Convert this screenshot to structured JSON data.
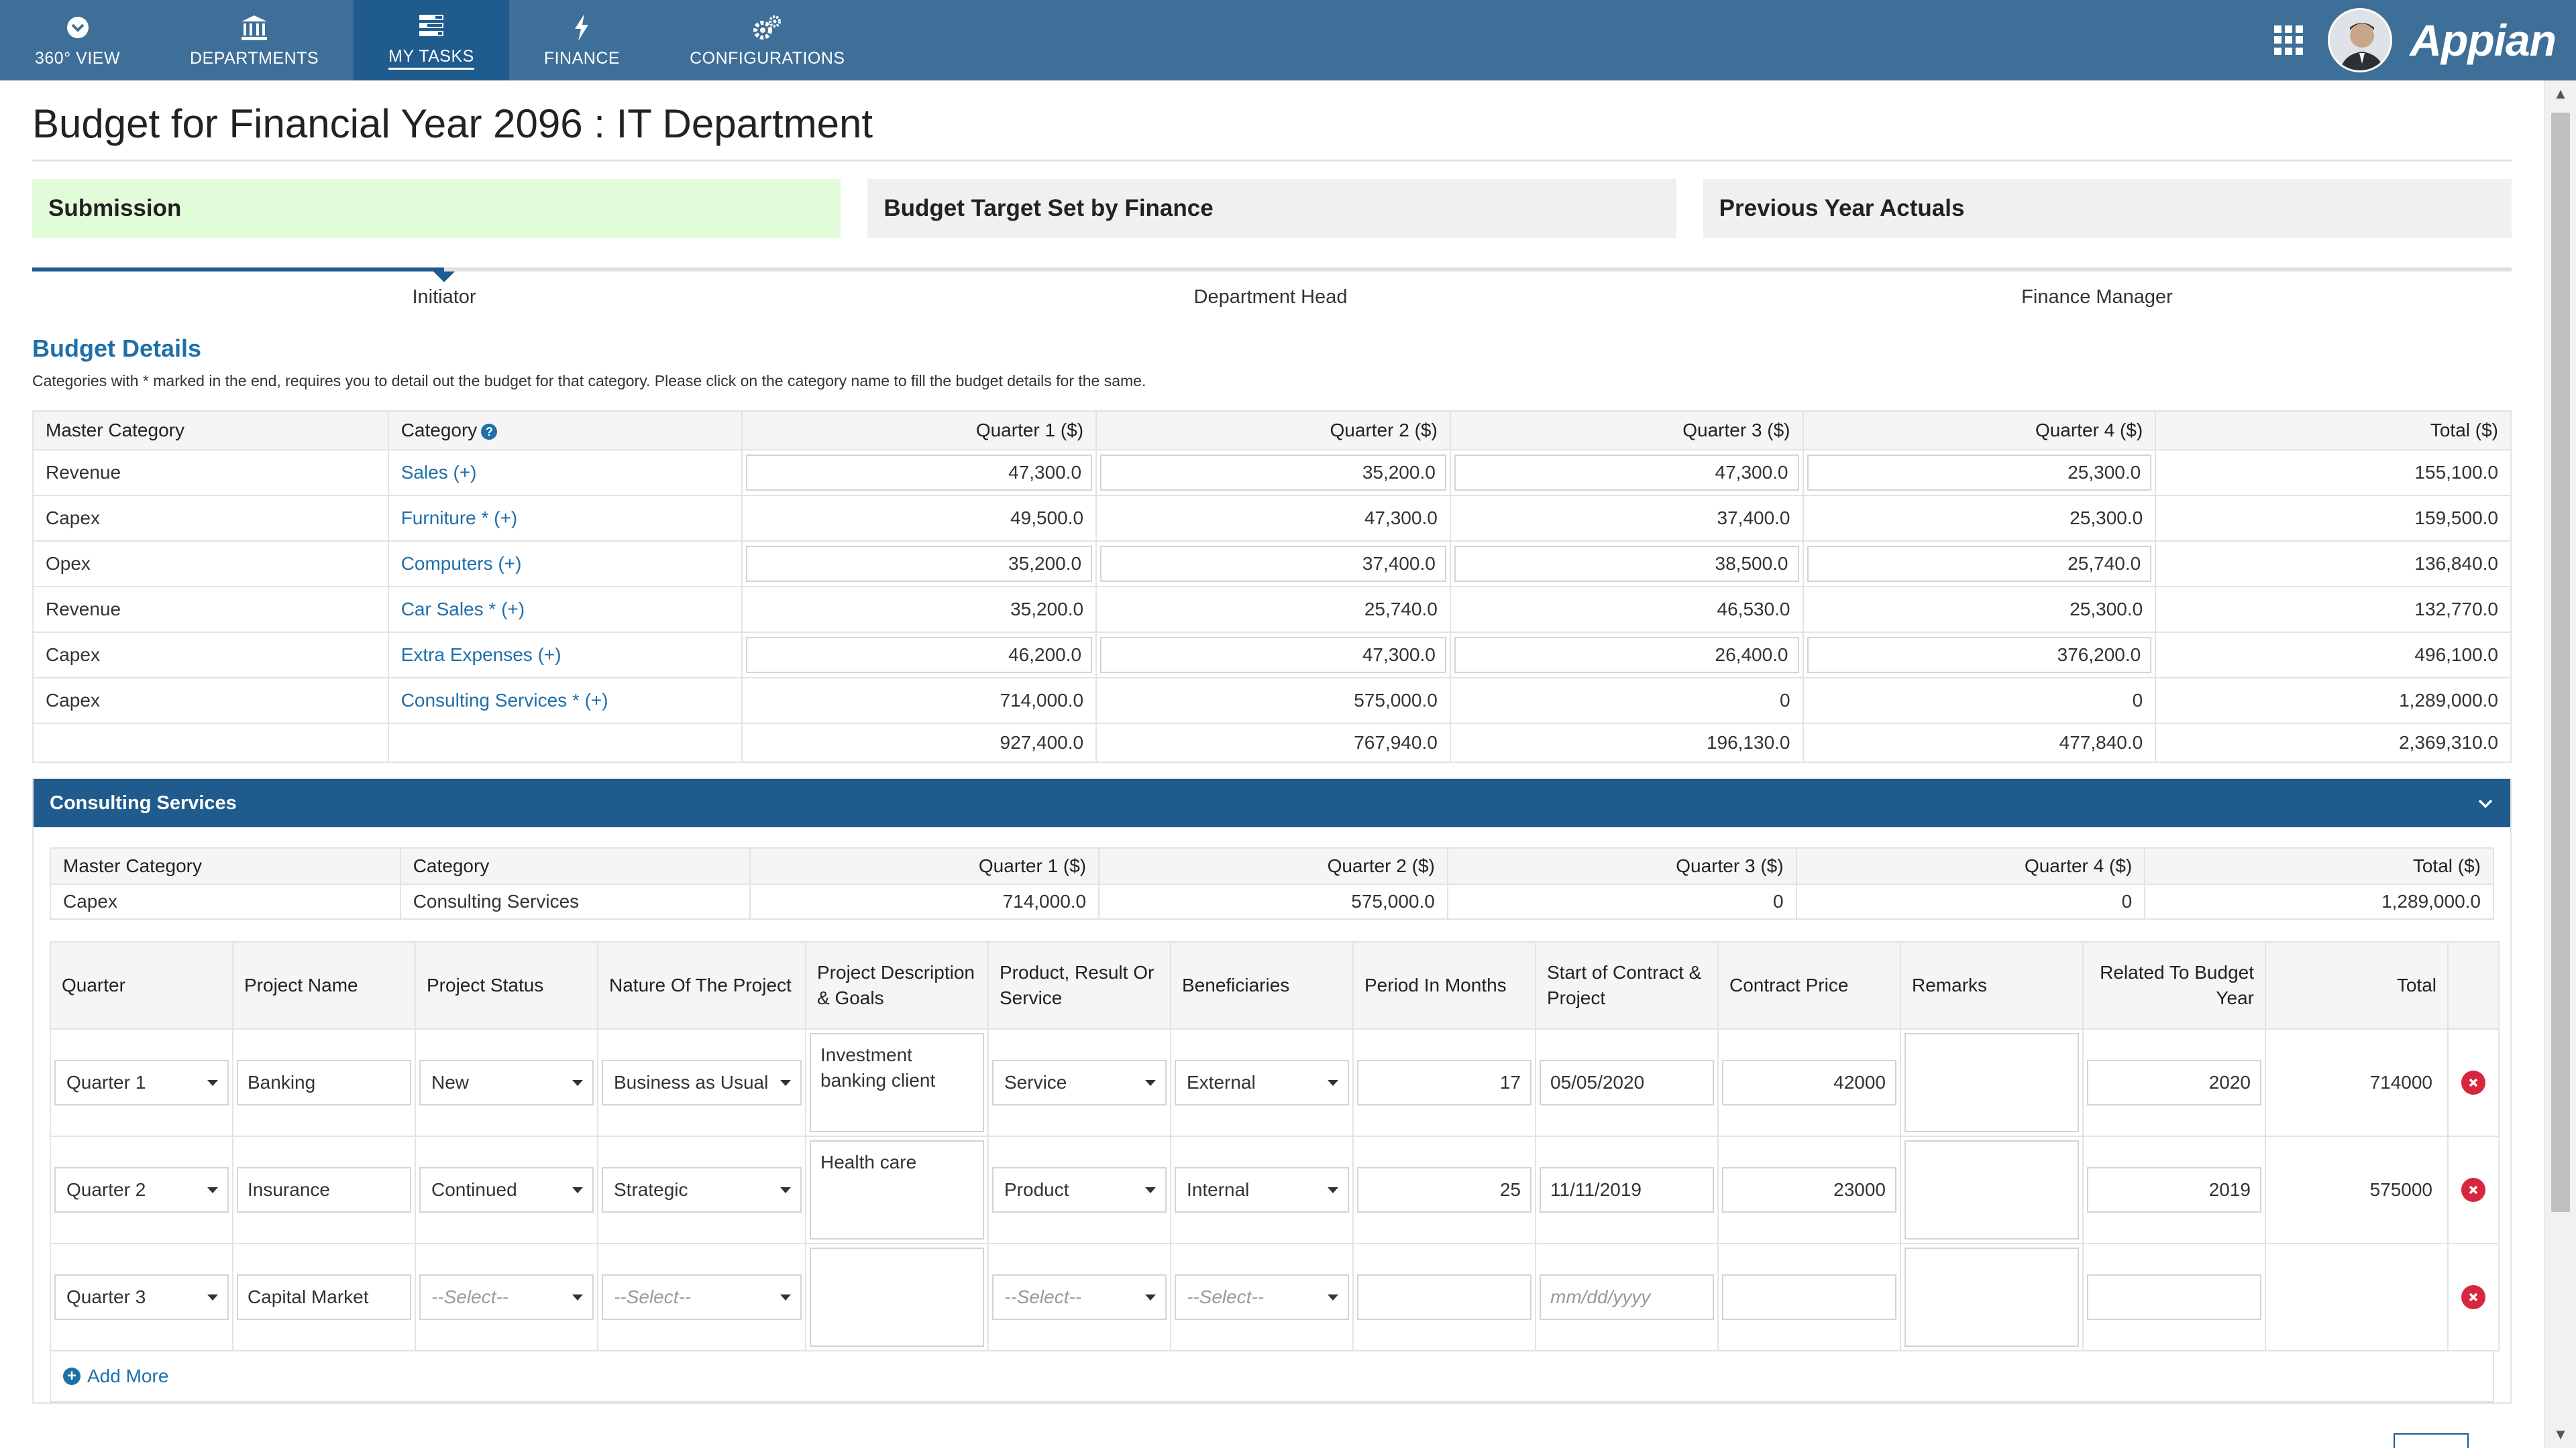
{
  "nav": {
    "items": [
      {
        "label": "360° VIEW",
        "icon": "chevron-circle-down-icon"
      },
      {
        "label": "DEPARTMENTS",
        "icon": "bank-icon"
      },
      {
        "label": "MY TASKS",
        "icon": "tasks-icon",
        "active": true
      },
      {
        "label": "FINANCE",
        "icon": "bolt-icon"
      },
      {
        "label": "CONFIGURATIONS",
        "icon": "gears-icon"
      }
    ],
    "brand": "Appian"
  },
  "page": {
    "title": "Budget for Financial Year 2096 : IT Department"
  },
  "tiles": [
    {
      "label": "Submission",
      "active": true
    },
    {
      "label": "Budget Target Set by Finance"
    },
    {
      "label": "Previous Year Actuals"
    }
  ],
  "milestones": [
    "Initiator",
    "Department Head",
    "Finance Manager"
  ],
  "budget": {
    "title": "Budget Details",
    "note": "Categories with * marked in the end, requires you to detail out the budget for that category. Please click on the category name to fill the budget details for the same.",
    "headers": [
      "Master Category",
      "Category",
      "Quarter 1 ($)",
      "Quarter 2 ($)",
      "Quarter 3 ($)",
      "Quarter 4 ($)",
      "Total ($)"
    ],
    "rows": [
      {
        "master": "Revenue",
        "category": "Sales (+)",
        "q1": "47,300.0",
        "q2": "35,200.0",
        "q3": "47,300.0",
        "q4": "25,300.0",
        "total": "155,100.0",
        "editable": true
      },
      {
        "master": "Capex",
        "category": "Furniture * (+)",
        "q1": "49,500.0",
        "q2": "47,300.0",
        "q3": "37,400.0",
        "q4": "25,300.0",
        "total": "159,500.0",
        "editable": false
      },
      {
        "master": "Opex",
        "category": "Computers (+)",
        "q1": "35,200.0",
        "q2": "37,400.0",
        "q3": "38,500.0",
        "q4": "25,740.0",
        "total": "136,840.0",
        "editable": true
      },
      {
        "master": "Revenue",
        "category": "Car Sales * (+)",
        "q1": "35,200.0",
        "q2": "25,740.0",
        "q3": "46,530.0",
        "q4": "25,300.0",
        "total": "132,770.0",
        "editable": false
      },
      {
        "master": "Capex",
        "category": "Extra Expenses (+)",
        "q1": "46,200.0",
        "q2": "47,300.0",
        "q3": "26,400.0",
        "q4": "376,200.0",
        "total": "496,100.0",
        "editable": true
      },
      {
        "master": "Capex",
        "category": "Consulting Services * (+)",
        "q1": "714,000.0",
        "q2": "575,000.0",
        "q3": "0",
        "q4": "0",
        "total": "1,289,000.0",
        "editable": false
      }
    ],
    "totals": {
      "q1": "927,400.0",
      "q2": "767,940.0",
      "q3": "196,130.0",
      "q4": "477,840.0",
      "total": "2,369,310.0"
    }
  },
  "consulting": {
    "title": "Consulting Services",
    "summary_headers": [
      "Master Category",
      "Category",
      "Quarter 1 ($)",
      "Quarter 2 ($)",
      "Quarter 3 ($)",
      "Quarter 4 ($)",
      "Total ($)"
    ],
    "summary_row": {
      "master": "Capex",
      "category": "Consulting Services",
      "q1": "714,000.0",
      "q2": "575,000.0",
      "q3": "0",
      "q4": "0",
      "total": "1,289,000.0"
    },
    "project_headers": [
      "Quarter",
      "Project Name",
      "Project Status",
      "Nature Of The Project",
      "Project Description & Goals",
      "Product, Result Or Service",
      "Beneficiaries",
      "Period In Months",
      "Start of Contract & Project",
      "Contract Price",
      "Remarks",
      "Related To Budget Year",
      "Total"
    ],
    "projects": [
      {
        "quarter": "Quarter 1",
        "name": "Banking",
        "status": "New",
        "nature": "Business as Usual",
        "description": "Investment banking client",
        "product": "Service",
        "beneficiaries": "External",
        "period": "17",
        "start": "05/05/2020",
        "price": "42000",
        "remarks": "",
        "budget_year": "2020",
        "total": "714000"
      },
      {
        "quarter": "Quarter 2",
        "name": "Insurance",
        "status": "Continued",
        "nature": "Strategic",
        "description": "Health care",
        "product": "Product",
        "beneficiaries": "Internal",
        "period": "25",
        "start": "11/11/2019",
        "price": "23000",
        "remarks": "",
        "budget_year": "2019",
        "total": "575000"
      },
      {
        "quarter": "Quarter 3",
        "name": "Capital Market",
        "status": "--Select--",
        "nature": "--Select--",
        "description": "",
        "product": "--Select--",
        "beneficiaries": "--Select--",
        "period": "",
        "start": "mm/dd/yyyy",
        "price": "",
        "remarks": "",
        "budget_year": "",
        "total": ""
      }
    ],
    "add_more": "Add More"
  }
}
